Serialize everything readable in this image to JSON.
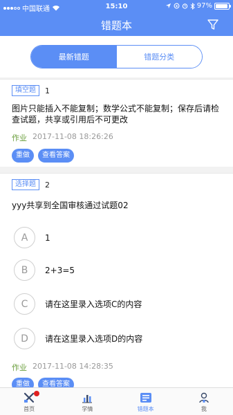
{
  "status_bar": {
    "carrier": "中国联通",
    "time": "15:10",
    "battery": "97%",
    "battery_level": 0.97
  },
  "nav": {
    "title": "错题本"
  },
  "segments": [
    "最新错题",
    "错题分类"
  ],
  "questions": [
    {
      "type": "填空题",
      "number": "1",
      "text": "图片只能插入不能复制；数学公式不能复制；保存后请检查试题，共享或引用后不可更改",
      "source": "作业",
      "time": "2017-11-08 18:26:26",
      "actions": [
        "重做",
        "查看答案"
      ]
    },
    {
      "type": "选择题",
      "number": "2",
      "text": "yyy共享到全国审核通过试题02",
      "options": [
        {
          "letter": "A",
          "text": "1"
        },
        {
          "letter": "B",
          "text": "2+3=5"
        },
        {
          "letter": "C",
          "text": "请在这里录入选项C的内容"
        },
        {
          "letter": "D",
          "text": "请在这里录入选项D的内容"
        }
      ],
      "source": "作业",
      "time": "2017-11-08 14:28:35",
      "actions": [
        "重做",
        "查看答案"
      ]
    }
  ],
  "tabbar": [
    {
      "label": "首页",
      "icon": "home-tools-icon"
    },
    {
      "label": "学情",
      "icon": "bar-chart-icon"
    },
    {
      "label": "错题本",
      "icon": "notebook-icon"
    },
    {
      "label": "我",
      "icon": "person-icon"
    }
  ],
  "colors": {
    "accent": "#5b8ef5",
    "source_green": "#6a9e3c",
    "badge_red": "#e02020"
  }
}
